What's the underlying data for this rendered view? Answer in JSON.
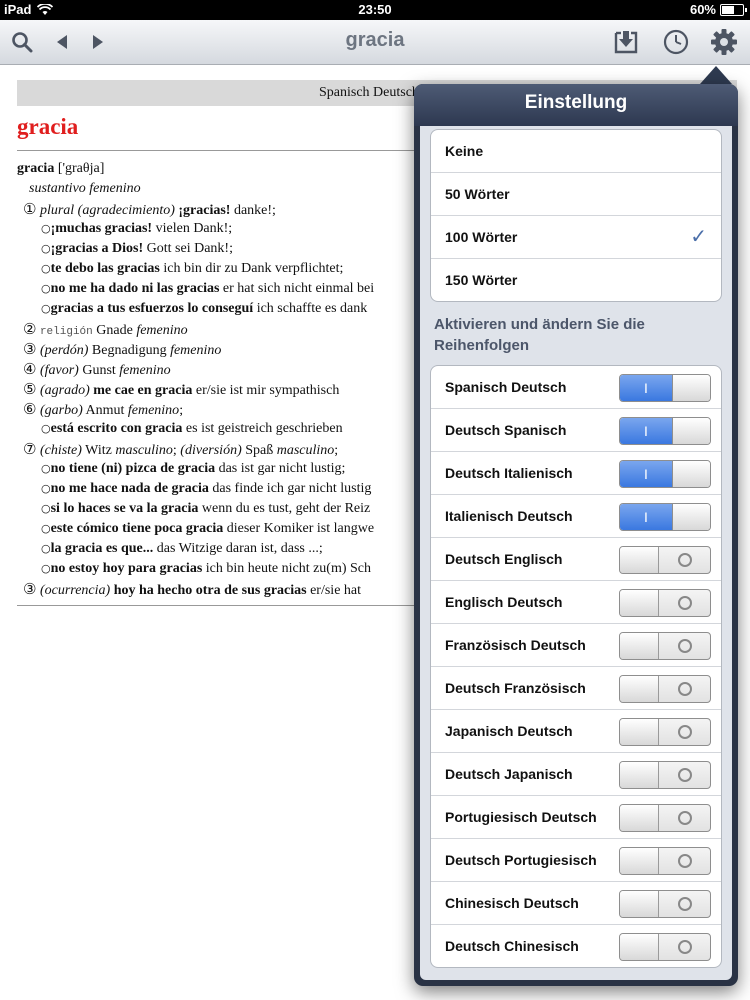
{
  "status": {
    "carrier": "iPad",
    "time": "23:50",
    "battery": "60%",
    "battery_level": 0.6
  },
  "toolbar": {
    "title": "gracia"
  },
  "dictionary": {
    "header": "Spanisch Deutsch",
    "headword": "gracia",
    "entry_word": "gracia",
    "pronunciation": " ['graθja]",
    "pos": "sustantivo femenino",
    "lines": [
      {
        "type": "sense",
        "num": "①",
        "parts": [
          {
            "t": "plural (agradecimiento) ",
            "i": true
          },
          {
            "t": "¡gracias!",
            "b": true
          },
          {
            "t": " danke!;"
          }
        ]
      },
      {
        "type": "ex",
        "parts": [
          {
            "t": "¡muchas gracias!",
            "b": true
          },
          {
            "t": " vielen Dank!;"
          }
        ]
      },
      {
        "type": "ex",
        "parts": [
          {
            "t": "¡gracias a Dios!",
            "b": true
          },
          {
            "t": " Gott sei Dank!;"
          }
        ]
      },
      {
        "type": "ex",
        "parts": [
          {
            "t": "te debo las gracias",
            "b": true
          },
          {
            "t": " ich bin dir zu Dank verpflichtet;"
          }
        ]
      },
      {
        "type": "ex",
        "parts": [
          {
            "t": "no me ha dado ni las gracias",
            "b": true
          },
          {
            "t": " er hat sich nicht einmal bei"
          }
        ]
      },
      {
        "type": "ex",
        "parts": [
          {
            "t": "gracias a tus esfuerzos lo conseguí",
            "b": true
          },
          {
            "t": " ich schaffte es dank"
          }
        ]
      },
      {
        "type": "sense",
        "num": "②",
        "parts": [
          {
            "t": "religión",
            "tag": true
          },
          {
            "t": " Gnade "
          },
          {
            "t": "femenino",
            "i": true
          }
        ]
      },
      {
        "type": "sense",
        "num": "③",
        "parts": [
          {
            "t": "(perdón)",
            "i": true
          },
          {
            "t": " Begnadigung "
          },
          {
            "t": "femenino",
            "i": true
          }
        ]
      },
      {
        "type": "sense",
        "num": "④",
        "parts": [
          {
            "t": "(favor)",
            "i": true
          },
          {
            "t": " Gunst "
          },
          {
            "t": "femenino",
            "i": true
          }
        ]
      },
      {
        "type": "sense",
        "num": "⑤",
        "parts": [
          {
            "t": "(agrado)",
            "i": true
          },
          {
            "t": " "
          },
          {
            "t": "me cae en gracia",
            "b": true
          },
          {
            "t": " er/sie ist mir sympathisch"
          }
        ]
      },
      {
        "type": "sense",
        "num": "⑥",
        "parts": [
          {
            "t": "(garbo)",
            "i": true
          },
          {
            "t": " Anmut "
          },
          {
            "t": "femenino",
            "i": true
          },
          {
            "t": ";"
          }
        ]
      },
      {
        "type": "ex",
        "parts": [
          {
            "t": "está escrito con gracia",
            "b": true
          },
          {
            "t": " es ist geistreich geschrieben"
          }
        ]
      },
      {
        "type": "sense",
        "num": "⑦",
        "parts": [
          {
            "t": "(chiste)",
            "i": true
          },
          {
            "t": " Witz "
          },
          {
            "t": "masculino",
            "i": true
          },
          {
            "t": "; "
          },
          {
            "t": "(diversión)",
            "i": true
          },
          {
            "t": " Spaß "
          },
          {
            "t": "masculino",
            "i": true
          },
          {
            "t": ";"
          }
        ]
      },
      {
        "type": "ex",
        "parts": [
          {
            "t": "no tiene (ni) pizca de gracia",
            "b": true
          },
          {
            "t": " das ist gar nicht lustig;"
          }
        ]
      },
      {
        "type": "ex",
        "parts": [
          {
            "t": "no me hace nada de gracia",
            "b": true
          },
          {
            "t": " das finde ich gar nicht lustig"
          }
        ]
      },
      {
        "type": "ex",
        "parts": [
          {
            "t": "si lo haces se va la gracia",
            "b": true
          },
          {
            "t": " wenn du es tust, geht der Reiz"
          }
        ]
      },
      {
        "type": "ex",
        "parts": [
          {
            "t": "este cómico tiene poca gracia",
            "b": true
          },
          {
            "t": " dieser Komiker ist langwe"
          }
        ]
      },
      {
        "type": "ex",
        "parts": [
          {
            "t": "la gracia es que...",
            "b": true
          },
          {
            "t": " das Witzige daran ist, dass ...;"
          }
        ]
      },
      {
        "type": "ex",
        "parts": [
          {
            "t": "no estoy hoy para gracias",
            "b": true
          },
          {
            "t": " ich bin heute nicht zu(m) Sch"
          }
        ]
      },
      {
        "type": "sense",
        "num": "③",
        "parts": [
          {
            "t": "(ocurrencia)",
            "i": true
          },
          {
            "t": " "
          },
          {
            "t": "hoy ha hecho otra de sus gracias",
            "b": true
          },
          {
            "t": " er/sie hat"
          }
        ]
      }
    ]
  },
  "settings": {
    "title": "Einstellung",
    "history_options": [
      {
        "label": "Keine",
        "selected": false
      },
      {
        "label": "50 Wörter",
        "selected": false
      },
      {
        "label": "100 Wörter",
        "selected": true
      },
      {
        "label": "150 Wörter",
        "selected": false
      }
    ],
    "check_mark": "✓",
    "section_label": "Aktivieren und ändern Sie die Reihenfolgen",
    "on_text": "I",
    "dictionaries": [
      {
        "label": "Spanisch Deutsch",
        "on": true
      },
      {
        "label": "Deutsch Spanisch",
        "on": true
      },
      {
        "label": "Deutsch Italienisch",
        "on": true
      },
      {
        "label": "Italienisch Deutsch",
        "on": true
      },
      {
        "label": "Deutsch Englisch",
        "on": false
      },
      {
        "label": "Englisch Deutsch",
        "on": false
      },
      {
        "label": "Französisch Deutsch",
        "on": false
      },
      {
        "label": "Deutsch Französisch",
        "on": false
      },
      {
        "label": "Japanisch Deutsch",
        "on": false
      },
      {
        "label": "Deutsch Japanisch",
        "on": false
      },
      {
        "label": "Portugiesisch Deutsch",
        "on": false
      },
      {
        "label": "Deutsch Portugiesisch",
        "on": false
      },
      {
        "label": "Chinesisch Deutsch",
        "on": false
      },
      {
        "label": "Deutsch Chinesisch",
        "on": false
      }
    ]
  }
}
